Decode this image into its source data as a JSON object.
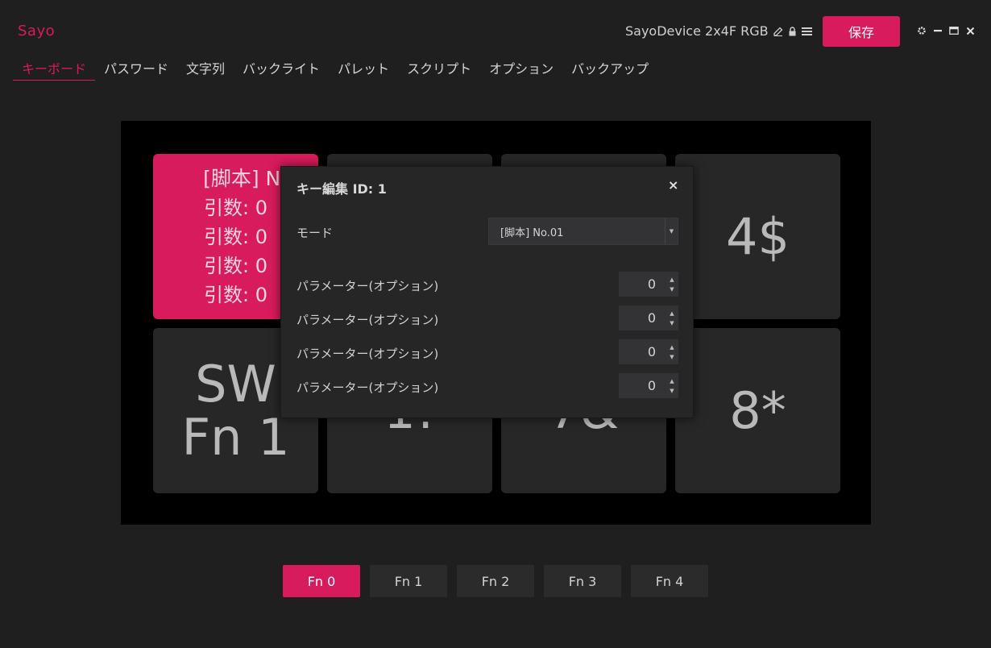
{
  "app": {
    "logo": "Sayo"
  },
  "header": {
    "device_name": "SayoDevice 2x4F RGB",
    "save_label": "保存"
  },
  "tabs": [
    "キーボード",
    "パスワード",
    "文字列",
    "バックライト",
    "パレット",
    "スクリプト",
    "オプション",
    "バックアップ"
  ],
  "active_tab": "キーボード",
  "keys": {
    "k1": {
      "lines": [
        "[脚本] No.0",
        "引数: 0",
        "引数: 0",
        "引数: 0",
        "引数: 0"
      ]
    },
    "k4": {
      "label": "4$"
    },
    "k5": {
      "line1": "SW",
      "line2": "Fn 1"
    },
    "k6": {
      "label": "1!"
    },
    "k7": {
      "label": "7&"
    },
    "k8": {
      "label": "8*"
    }
  },
  "fn_layers": [
    "Fn 0",
    "Fn 1",
    "Fn 2",
    "Fn 3",
    "Fn 4"
  ],
  "active_fn": "Fn 0",
  "dialog": {
    "title": "キー編集 ID: 1",
    "close_glyph": "×",
    "mode_label": "モード",
    "mode_value": "[脚本] No.01",
    "params": [
      {
        "label": "パラメーター(オプション)",
        "value": "0"
      },
      {
        "label": "パラメーター(オプション)",
        "value": "0"
      },
      {
        "label": "パラメーター(オプション)",
        "value": "0"
      },
      {
        "label": "パラメーター(オプション)",
        "value": "0"
      }
    ]
  },
  "colors": {
    "accent": "#d81b5c",
    "background": "#1f1f20",
    "key": "#272728",
    "board": "#000000"
  }
}
